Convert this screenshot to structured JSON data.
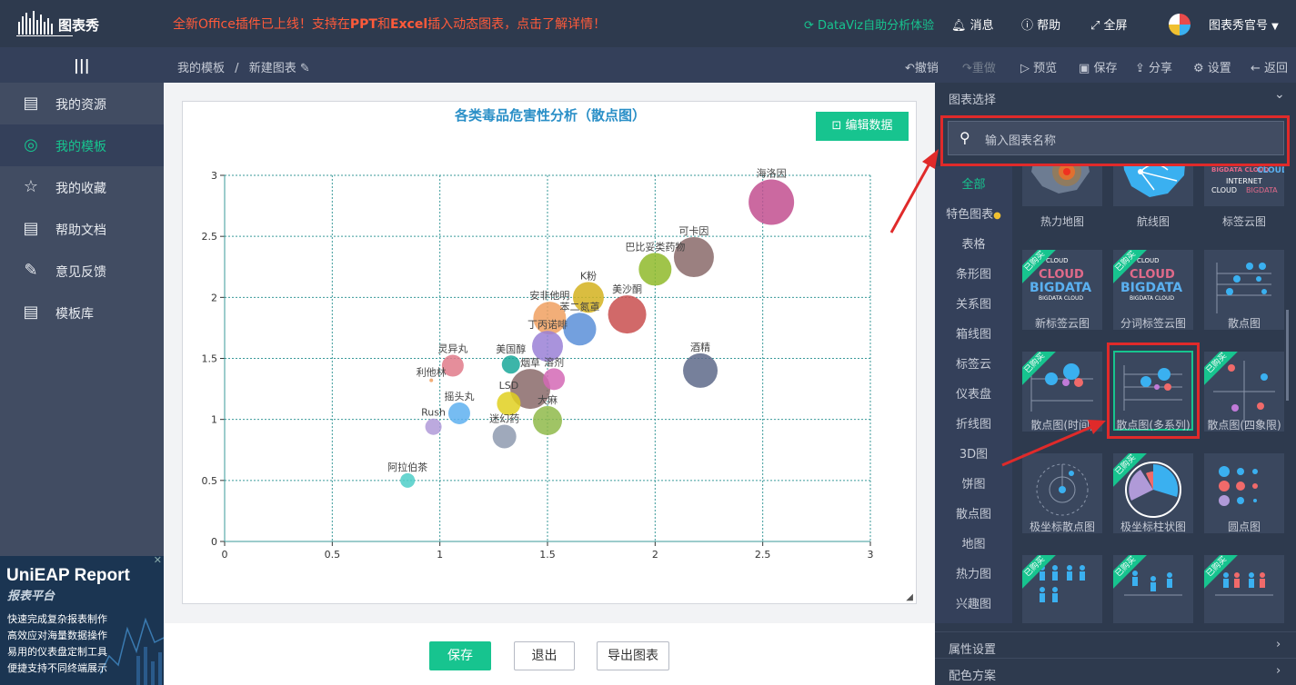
{
  "topbar": {
    "logo_text": "图表秀",
    "announcement_part1": "全新Office插件已上线！支持在",
    "announcement_ppt": "PPT",
    "announcement_and": "和",
    "announcement_excel": "Excel",
    "announcement_part2": "插入动态图表，点击了解详情！",
    "dataviz": "DataViz自助分析体验",
    "messages": "消息",
    "help": "帮助",
    "fullscreen": "全屏",
    "username": "图表秀官号"
  },
  "navbar": {
    "breadcrumb_root": "我的模板",
    "breadcrumb_sep": "/",
    "breadcrumb_current": "新建图表",
    "undo": "撤销",
    "redo": "重做",
    "preview": "预览",
    "save": "保存",
    "share": "分享",
    "settings": "设置",
    "back": "返回"
  },
  "sidebar": {
    "items": [
      {
        "label": "我的资源"
      },
      {
        "label": "我的模板"
      },
      {
        "label": "我的收藏"
      },
      {
        "label": "帮助文档"
      },
      {
        "label": "意见反馈"
      },
      {
        "label": "模板库"
      }
    ]
  },
  "ad": {
    "title": "UniEAP Report",
    "subtitle": "报表平台",
    "lines": [
      "快速完成复杂报表制作",
      "高效应对海量数据操作",
      "易用的仪表盘定制工具",
      "便捷支持不同终端展示"
    ]
  },
  "editor": {
    "edit_data": "编辑数据",
    "save": "保存",
    "exit": "退出",
    "export": "导出图表"
  },
  "chart_data": {
    "type": "scatter",
    "title": "各类毒品危害性分析（散点图）",
    "xlim": [
      0,
      3
    ],
    "ylim": [
      0,
      3
    ],
    "xticks": [
      "0",
      "0.5",
      "1",
      "1.5",
      "2",
      "2.5",
      "3"
    ],
    "yticks": [
      "0",
      "0.5",
      "1",
      "1.5",
      "2",
      "2.5",
      "3"
    ],
    "grid": true,
    "points": [
      {
        "name": "海洛因",
        "x": 2.54,
        "y": 2.78,
        "size": 25,
        "color": "#c24f8f"
      },
      {
        "name": "可卡因",
        "x": 2.18,
        "y": 2.33,
        "size": 22,
        "color": "#8a6a6a"
      },
      {
        "name": "巴比妥类药物",
        "x": 2.0,
        "y": 2.23,
        "size": 18,
        "color": "#8fba2a"
      },
      {
        "name": "美沙酮",
        "x": 1.87,
        "y": 1.86,
        "size": 21,
        "color": "#c94f4f"
      },
      {
        "name": "K粉",
        "x": 1.69,
        "y": 2.0,
        "size": 17,
        "color": "#d4b21e"
      },
      {
        "name": "苯二氮䓬",
        "x": 1.65,
        "y": 1.74,
        "size": 18,
        "color": "#5b8fd8"
      },
      {
        "name": "安非他明",
        "x": 1.51,
        "y": 1.83,
        "size": 18,
        "color": "#f0a060"
      },
      {
        "name": "丁丙诺啡",
        "x": 1.5,
        "y": 1.6,
        "size": 17,
        "color": "#9a80d6"
      },
      {
        "name": "酒精",
        "x": 2.21,
        "y": 1.4,
        "size": 19,
        "color": "#5e6a8a"
      },
      {
        "name": "烟草",
        "x": 1.42,
        "y": 1.25,
        "size": 22,
        "color": "#8a6a6a"
      },
      {
        "name": "溶剂",
        "x": 1.53,
        "y": 1.33,
        "size": 12,
        "color": "#d469b5"
      },
      {
        "name": "美国醇",
        "x": 1.33,
        "y": 1.45,
        "size": 10,
        "color": "#1aa89a"
      },
      {
        "name": "LSD",
        "x": 1.32,
        "y": 1.13,
        "size": 13,
        "color": "#e0d020"
      },
      {
        "name": "大麻",
        "x": 1.5,
        "y": 0.99,
        "size": 16,
        "color": "#8fba4a"
      },
      {
        "name": "迷幻药",
        "x": 1.3,
        "y": 0.86,
        "size": 13,
        "color": "#8e9aaf"
      },
      {
        "name": "灵异丸",
        "x": 1.06,
        "y": 1.44,
        "size": 12,
        "color": "#e07a8a"
      },
      {
        "name": "利他林",
        "x": 0.96,
        "y": 1.32,
        "size": 2,
        "color": "#f0a060"
      },
      {
        "name": "摇头丸",
        "x": 1.09,
        "y": 1.05,
        "size": 12,
        "color": "#5eb0f0"
      },
      {
        "name": "Rush",
        "x": 0.97,
        "y": 0.94,
        "size": 9,
        "color": "#b09ad8"
      },
      {
        "name": "阿拉伯茶",
        "x": 0.85,
        "y": 0.5,
        "size": 8,
        "color": "#4ecec8"
      }
    ]
  },
  "rightpanel": {
    "section_title": "图表选择",
    "search_placeholder": "输入图表名称",
    "categories": [
      "全部",
      "特色图表",
      "表格",
      "条形图",
      "关系图",
      "箱线图",
      "标签云",
      "仪表盘",
      "折线图",
      "3D图",
      "饼图",
      "散点图",
      "地图",
      "热力图",
      "兴趣图"
    ],
    "charts": [
      {
        "label": "热力地图",
        "bought": false
      },
      {
        "label": "航线图",
        "bought": false
      },
      {
        "label": "标签云图",
        "bought": false
      },
      {
        "label": "新标签云图",
        "bought": true
      },
      {
        "label": "分词标签云图",
        "bought": true
      },
      {
        "label": "散点图",
        "bought": false
      },
      {
        "label": "散点图(时间)",
        "bought": true
      },
      {
        "label": "散点图(多系列)",
        "bought": false
      },
      {
        "label": "散点图(四象限)",
        "bought": true
      },
      {
        "label": "极坐标散点图",
        "bought": false
      },
      {
        "label": "极坐标柱状图",
        "bought": true
      },
      {
        "label": "圆点图",
        "bought": false
      },
      {
        "label": "",
        "bought": true
      },
      {
        "label": "",
        "bought": true
      },
      {
        "label": "",
        "bought": true
      }
    ],
    "bought_badge": "已购买",
    "tile_text": {
      "cloud": "CLOUD",
      "bigdata": "BIGDATA",
      "bigdata_cloud": "BIGDATA CLOUD",
      "internet": "INTERNET"
    },
    "attr_settings": "属性设置",
    "color_scheme": "配色方案"
  },
  "colors": {
    "accent": "#17c48f",
    "highlight": "#e02a2a",
    "topbar": "#2e3a4e",
    "title": "#2a8fc7"
  }
}
